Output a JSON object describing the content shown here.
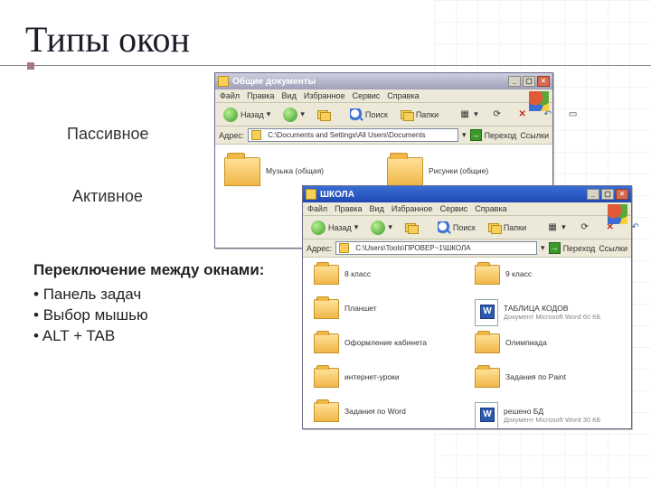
{
  "slide": {
    "title": "Типы окон",
    "label_passive": "Пассивное",
    "label_active": "Активное",
    "switch_heading": "Переключение между окнами:",
    "switch_items": [
      "Панель задач",
      "Выбор мышью",
      "ALT + TAB"
    ]
  },
  "back_window": {
    "title": "Общие документы",
    "menu": [
      "Файл",
      "Правка",
      "Вид",
      "Избранное",
      "Сервис",
      "Справка"
    ],
    "toolbar": {
      "back": "Назад",
      "search": "Поиск",
      "folders": "Папки"
    },
    "address": {
      "label": "Адрес:",
      "value": "C:\\Documents and Settings\\All Users\\Documents",
      "go": "Переход",
      "links": "Ссылки"
    },
    "items": [
      {
        "name": "Музыка (общая)"
      },
      {
        "name": "Рисунки (общие)"
      }
    ]
  },
  "front_window": {
    "title": "ШКОЛА",
    "menu": [
      "Файл",
      "Правка",
      "Вид",
      "Избранное",
      "Сервис",
      "Справка"
    ],
    "toolbar": {
      "back": "Назад",
      "search": "Поиск",
      "folders": "Папки"
    },
    "address": {
      "label": "Адрес:",
      "value": "C:\\Users\\Tools\\ПРОВЕР~1\\ШКОЛА",
      "go": "Переход",
      "links": "Ссылки"
    },
    "col1": [
      {
        "name": "8 класс"
      },
      {
        "name": "Планшет"
      },
      {
        "name": "Оформление кабинета"
      },
      {
        "name": "интернет-уроки"
      },
      {
        "name": "Задания по Word"
      }
    ],
    "col2": [
      {
        "name": "9 класс",
        "type": "folder"
      },
      {
        "name": "ТАБЛИЦА КОДОВ",
        "type": "word",
        "sub": "Документ Microsoft Word\n60 КБ"
      },
      {
        "name": "Олимпиада",
        "type": "folder"
      },
      {
        "name": "Задания по Paint",
        "type": "folder"
      },
      {
        "name": "решено БД",
        "type": "word",
        "sub": "Документ Microsoft Word\n30 КБ"
      }
    ]
  }
}
